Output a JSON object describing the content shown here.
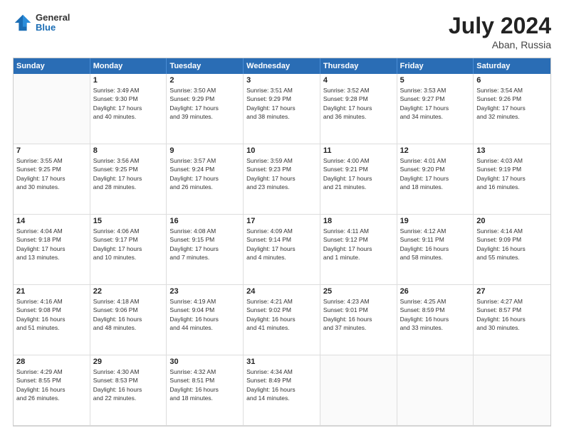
{
  "header": {
    "logo_line1": "General",
    "logo_line2": "Blue",
    "month_year": "July 2024",
    "location": "Aban, Russia"
  },
  "weekdays": [
    "Sunday",
    "Monday",
    "Tuesday",
    "Wednesday",
    "Thursday",
    "Friday",
    "Saturday"
  ],
  "weeks": [
    [
      {
        "day": "",
        "info": ""
      },
      {
        "day": "1",
        "info": "Sunrise: 3:49 AM\nSunset: 9:30 PM\nDaylight: 17 hours\nand 40 minutes."
      },
      {
        "day": "2",
        "info": "Sunrise: 3:50 AM\nSunset: 9:29 PM\nDaylight: 17 hours\nand 39 minutes."
      },
      {
        "day": "3",
        "info": "Sunrise: 3:51 AM\nSunset: 9:29 PM\nDaylight: 17 hours\nand 38 minutes."
      },
      {
        "day": "4",
        "info": "Sunrise: 3:52 AM\nSunset: 9:28 PM\nDaylight: 17 hours\nand 36 minutes."
      },
      {
        "day": "5",
        "info": "Sunrise: 3:53 AM\nSunset: 9:27 PM\nDaylight: 17 hours\nand 34 minutes."
      },
      {
        "day": "6",
        "info": "Sunrise: 3:54 AM\nSunset: 9:26 PM\nDaylight: 17 hours\nand 32 minutes."
      }
    ],
    [
      {
        "day": "7",
        "info": "Sunrise: 3:55 AM\nSunset: 9:25 PM\nDaylight: 17 hours\nand 30 minutes."
      },
      {
        "day": "8",
        "info": "Sunrise: 3:56 AM\nSunset: 9:25 PM\nDaylight: 17 hours\nand 28 minutes."
      },
      {
        "day": "9",
        "info": "Sunrise: 3:57 AM\nSunset: 9:24 PM\nDaylight: 17 hours\nand 26 minutes."
      },
      {
        "day": "10",
        "info": "Sunrise: 3:59 AM\nSunset: 9:23 PM\nDaylight: 17 hours\nand 23 minutes."
      },
      {
        "day": "11",
        "info": "Sunrise: 4:00 AM\nSunset: 9:21 PM\nDaylight: 17 hours\nand 21 minutes."
      },
      {
        "day": "12",
        "info": "Sunrise: 4:01 AM\nSunset: 9:20 PM\nDaylight: 17 hours\nand 18 minutes."
      },
      {
        "day": "13",
        "info": "Sunrise: 4:03 AM\nSunset: 9:19 PM\nDaylight: 17 hours\nand 16 minutes."
      }
    ],
    [
      {
        "day": "14",
        "info": "Sunrise: 4:04 AM\nSunset: 9:18 PM\nDaylight: 17 hours\nand 13 minutes."
      },
      {
        "day": "15",
        "info": "Sunrise: 4:06 AM\nSunset: 9:17 PM\nDaylight: 17 hours\nand 10 minutes."
      },
      {
        "day": "16",
        "info": "Sunrise: 4:08 AM\nSunset: 9:15 PM\nDaylight: 17 hours\nand 7 minutes."
      },
      {
        "day": "17",
        "info": "Sunrise: 4:09 AM\nSunset: 9:14 PM\nDaylight: 17 hours\nand 4 minutes."
      },
      {
        "day": "18",
        "info": "Sunrise: 4:11 AM\nSunset: 9:12 PM\nDaylight: 17 hours\nand 1 minute."
      },
      {
        "day": "19",
        "info": "Sunrise: 4:12 AM\nSunset: 9:11 PM\nDaylight: 16 hours\nand 58 minutes."
      },
      {
        "day": "20",
        "info": "Sunrise: 4:14 AM\nSunset: 9:09 PM\nDaylight: 16 hours\nand 55 minutes."
      }
    ],
    [
      {
        "day": "21",
        "info": "Sunrise: 4:16 AM\nSunset: 9:08 PM\nDaylight: 16 hours\nand 51 minutes."
      },
      {
        "day": "22",
        "info": "Sunrise: 4:18 AM\nSunset: 9:06 PM\nDaylight: 16 hours\nand 48 minutes."
      },
      {
        "day": "23",
        "info": "Sunrise: 4:19 AM\nSunset: 9:04 PM\nDaylight: 16 hours\nand 44 minutes."
      },
      {
        "day": "24",
        "info": "Sunrise: 4:21 AM\nSunset: 9:02 PM\nDaylight: 16 hours\nand 41 minutes."
      },
      {
        "day": "25",
        "info": "Sunrise: 4:23 AM\nSunset: 9:01 PM\nDaylight: 16 hours\nand 37 minutes."
      },
      {
        "day": "26",
        "info": "Sunrise: 4:25 AM\nSunset: 8:59 PM\nDaylight: 16 hours\nand 33 minutes."
      },
      {
        "day": "27",
        "info": "Sunrise: 4:27 AM\nSunset: 8:57 PM\nDaylight: 16 hours\nand 30 minutes."
      }
    ],
    [
      {
        "day": "28",
        "info": "Sunrise: 4:29 AM\nSunset: 8:55 PM\nDaylight: 16 hours\nand 26 minutes."
      },
      {
        "day": "29",
        "info": "Sunrise: 4:30 AM\nSunset: 8:53 PM\nDaylight: 16 hours\nand 22 minutes."
      },
      {
        "day": "30",
        "info": "Sunrise: 4:32 AM\nSunset: 8:51 PM\nDaylight: 16 hours\nand 18 minutes."
      },
      {
        "day": "31",
        "info": "Sunrise: 4:34 AM\nSunset: 8:49 PM\nDaylight: 16 hours\nand 14 minutes."
      },
      {
        "day": "",
        "info": ""
      },
      {
        "day": "",
        "info": ""
      },
      {
        "day": "",
        "info": ""
      }
    ]
  ]
}
